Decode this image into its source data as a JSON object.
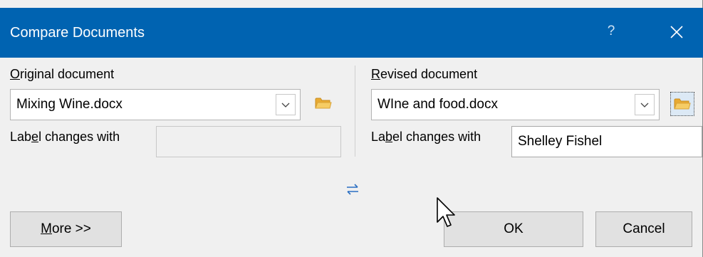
{
  "dialog": {
    "title": "Compare Documents",
    "help_label": "?",
    "close_icon": "close-icon"
  },
  "original": {
    "label_prefix": "",
    "label_access_key": "O",
    "label_rest": "riginal document",
    "file_value": "Mixing Wine.docx",
    "label_changes_prefix": "Lab",
    "label_changes_access_key": "e",
    "label_changes_rest": "l changes with",
    "label_changes_value": ""
  },
  "revised": {
    "label_prefix": "",
    "label_access_key": "R",
    "label_rest": "evised document",
    "file_value": "WIne and food.docx",
    "label_changes_prefix": "La",
    "label_changes_access_key": "b",
    "label_changes_rest": "el changes with",
    "label_changes_value": "Shelley Fishel"
  },
  "buttons": {
    "more_access_key": "M",
    "more_rest": "ore >>",
    "ok": "OK",
    "cancel": "Cancel"
  },
  "icons": {
    "browse": "folder-icon",
    "dropdown": "chevron-down-icon",
    "swap": "swap-arrows-icon",
    "cursor": "mouse-cursor-icon"
  },
  "colors": {
    "titlebar": "#0063b1",
    "dialog_bg": "#f0f0f0",
    "folder": "#f3c04f",
    "swap_arrows": "#2b6fc2"
  }
}
